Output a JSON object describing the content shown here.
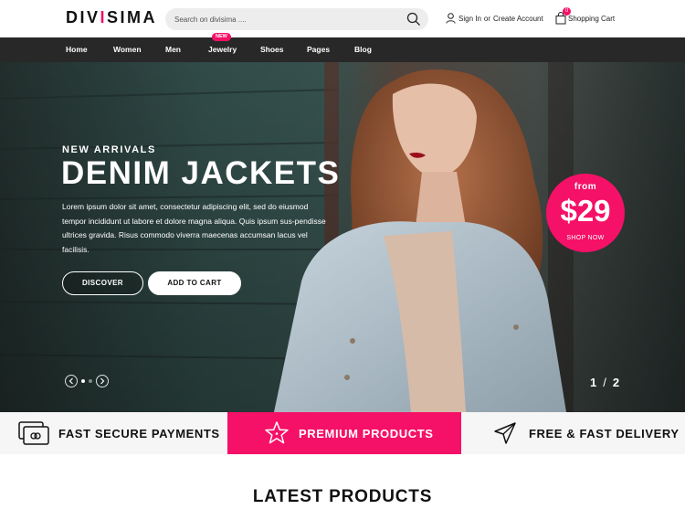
{
  "header": {
    "logo_text": "DIVISIMA",
    "search_placeholder": "Search on divisima ....",
    "sign_in": "Sign In",
    "or": "or",
    "create_account": "Create Account",
    "cart_label": "Shopping Cart",
    "cart_count": "0"
  },
  "nav": {
    "items": [
      "Home",
      "Women",
      "Men",
      "Jewelry",
      "Shoes",
      "Pages",
      "Blog"
    ],
    "new_badge": "NEW"
  },
  "hero": {
    "kicker": "NEW ARRIVALS",
    "title": "DENIM JACKETS",
    "text": "Lorem ipsum dolor sit amet, consectetur adipiscing elit, sed do eiusmod tempor incididunt ut labore et dolore magna aliqua. Quis ipsum sus-pendisse ultrices gravida. Risus commodo viverra maecenas accumsan lacus vel facilisis.",
    "discover": "DISCOVER",
    "add_to_cart": "ADD TO CART",
    "price_from": "from",
    "price": "$29",
    "shop_now": "SHOP NOW",
    "slide_current": "1",
    "slide_total": "2"
  },
  "features": [
    {
      "label": "FAST SECURE PAYMENTS",
      "icon": "credit-card-icon"
    },
    {
      "label": "PREMIUM PRODUCTS",
      "icon": "star-icon"
    },
    {
      "label": "FREE & FAST DELIVERY",
      "icon": "paper-plane-icon"
    }
  ],
  "section": {
    "latest_products": "LATEST PRODUCTS"
  },
  "colors": {
    "accent": "#f51167",
    "nav_bg": "#282828",
    "feature_bg": "#f6f6f6"
  }
}
